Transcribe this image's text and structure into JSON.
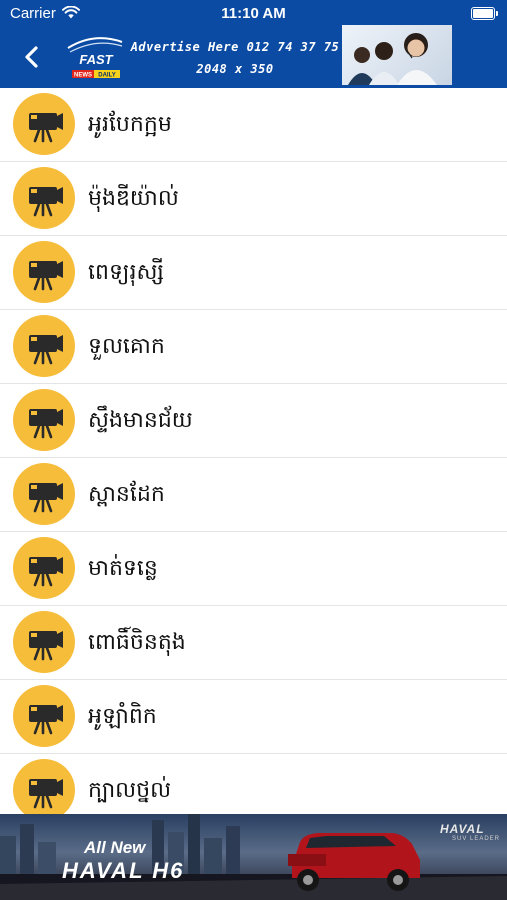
{
  "status_bar": {
    "carrier": "Carrier",
    "time": "11:10 AM"
  },
  "header": {
    "logo": {
      "brand": "FAST",
      "tagline_left": "NEWS",
      "tagline_right": "DAILY"
    },
    "ad": {
      "line1": "Advertise Here 012 74 37 75",
      "line2": "2048 x 350"
    }
  },
  "list": {
    "items": [
      {
        "label": "អូរបែកក្អម",
        "icon": "video-camera-icon"
      },
      {
        "label": "ម៉ុងឌីយ៉ាល់",
        "icon": "video-camera-icon"
      },
      {
        "label": "ពេទ្យរុស្សី",
        "icon": "video-camera-icon"
      },
      {
        "label": "ទួលគោក",
        "icon": "video-camera-icon"
      },
      {
        "label": "ស្ទឹងមានជ័យ",
        "icon": "video-camera-icon"
      },
      {
        "label": "ស្ពានដែក",
        "icon": "video-camera-icon"
      },
      {
        "label": "មាត់ទន្លេ",
        "icon": "video-camera-icon"
      },
      {
        "label": "ពោធិ៍ចិនតុង",
        "icon": "video-camera-icon"
      },
      {
        "label": "អូឡាំពិក",
        "icon": "video-camera-icon"
      },
      {
        "label": "ក្បាលថ្នល់",
        "icon": "video-camera-icon"
      }
    ]
  },
  "banner": {
    "line1": "All New",
    "line2": "HAVAL H6",
    "brand": "HAVAL",
    "sub": "SUV LEADER"
  },
  "colors": {
    "nav_blue": "#0b4ba3",
    "badge_yellow": "#f6bd3a",
    "divider": "#e4e4e4"
  }
}
